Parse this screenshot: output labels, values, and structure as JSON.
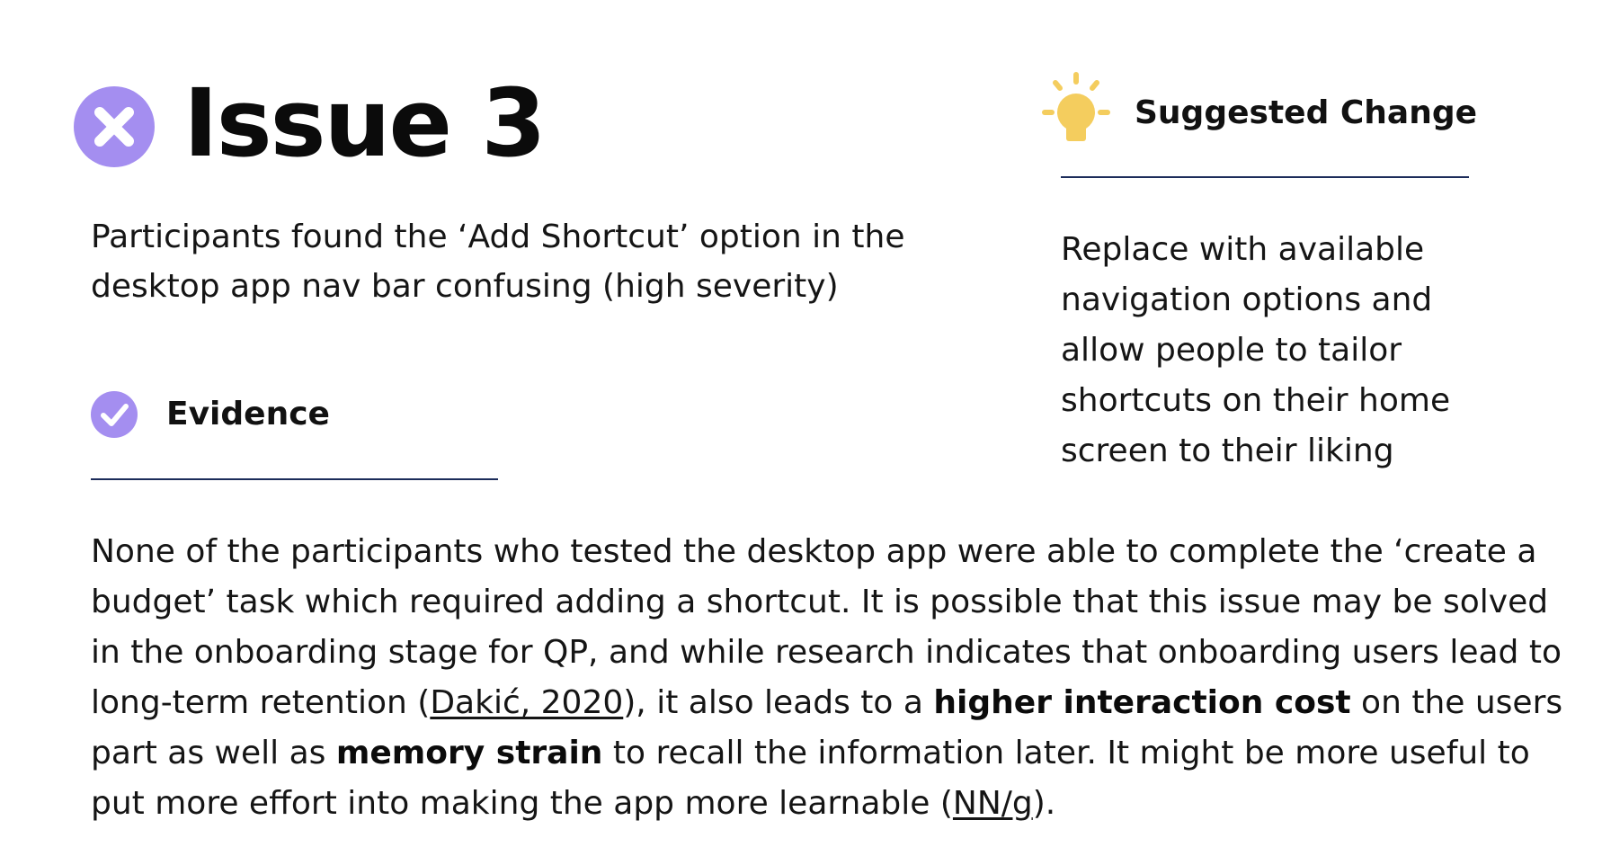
{
  "issue": {
    "title": "Issue 3",
    "icon": "x-circle-icon",
    "summary": "Participants found the ‘Add Shortcut’ option in the desktop app nav bar confusing (high severity)"
  },
  "evidence": {
    "label": "Evidence",
    "icon": "check-circle-icon",
    "body": {
      "p1": "None of the participants who tested the desktop app were able to complete the ‘create a budget’ task which required adding a shortcut. It is possible that this issue may be solved in the onboarding stage for QP, and while research indicates that onboarding users lead to long-term retention (",
      "link1": "Dakić, 2020",
      "p2": "), it also leads to a ",
      "bold1": "higher interaction cost",
      "p3": " on the users part as well as ",
      "bold2": "memory strain",
      "p4": " to recall the information later. It might be more useful to put more effort into making the app more learnable (",
      "link2": "NN/g",
      "p5": ")."
    }
  },
  "suggested_change": {
    "label": "Suggested Change",
    "icon": "lightbulb-icon",
    "text": "Replace with available navigation options and allow people to tailor shortcuts on their home screen to their liking"
  },
  "colors": {
    "icon_purple": "#a48ef0",
    "bulb_yellow": "#f4cd5e",
    "rule_navy": "#1c2c5a",
    "text": "#111111"
  }
}
